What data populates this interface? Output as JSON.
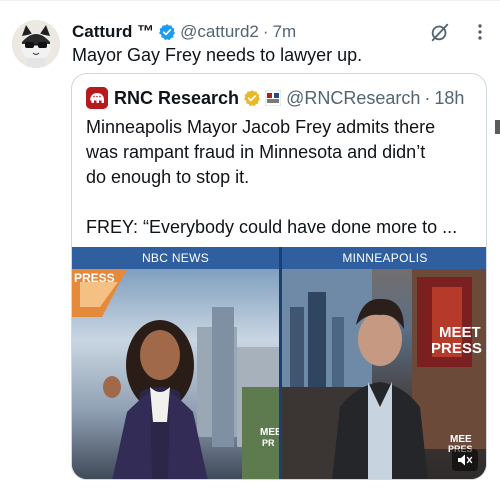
{
  "tweet": {
    "display_name": "Catturd ™",
    "handle": "@catturd2",
    "separator": "·",
    "time": "7m",
    "text": "Mayor Gay Frey needs to lawyer up."
  },
  "quote": {
    "display_name": "RNC Research",
    "handle": "@RNCResearch",
    "separator": "·",
    "time": "18h",
    "text_lines": [
      "Minneapolis Mayor Jacob Frey admits there",
      "was rampant fraud in Minnesota and didn’t",
      "do enough to stop it."
    ],
    "text_line_2": "FREY: “Everybody could have done more to ..."
  },
  "media": {
    "left_label": "NBC NEWS",
    "right_label": "MINNEAPOLIS",
    "overlay_press": "PRESS",
    "right_logo_line1": "MEET",
    "right_logo_line2": "PRESS",
    "corner_logo_left": "MEE",
    "corner_logo_left2": "PR",
    "corner_logo_right": "MEE",
    "corner_logo_right2": "PRES"
  },
  "icons": {
    "verified": "verified-badge-icon",
    "grok": "grok-icon",
    "more": "more-icon",
    "mute": "mute-icon"
  },
  "colors": {
    "verified_blue": "#1d9bf0",
    "verified_gold": "#e8b829",
    "text": "#0f1419",
    "secondary": "#536471",
    "border": "#cfd9de",
    "rnc_red": "#b7191d",
    "banner_blue": "#2f5f9e"
  }
}
